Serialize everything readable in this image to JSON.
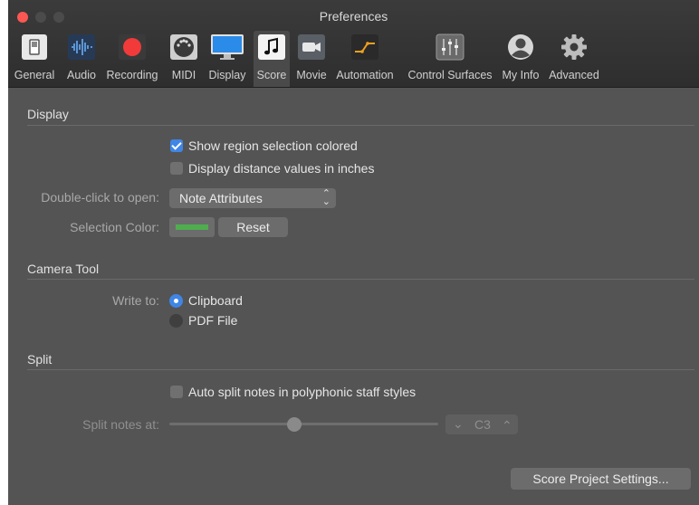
{
  "window": {
    "title": "Preferences"
  },
  "toolbar": {
    "items": [
      {
        "label": "General",
        "icon": "switch-icon"
      },
      {
        "label": "Audio",
        "icon": "waveform-icon"
      },
      {
        "label": "Recording",
        "icon": "record-icon"
      },
      {
        "label": "MIDI",
        "icon": "midi-connector-icon"
      },
      {
        "label": "Display",
        "icon": "monitor-icon"
      },
      {
        "label": "Score",
        "icon": "music-note-icon",
        "active": true
      },
      {
        "label": "Movie",
        "icon": "video-camera-icon"
      },
      {
        "label": "Automation",
        "icon": "automation-curve-icon"
      },
      {
        "label": "Control Surfaces",
        "icon": "faders-icon"
      },
      {
        "label": "My Info",
        "icon": "user-icon"
      },
      {
        "label": "Advanced",
        "icon": "gear-icon"
      }
    ]
  },
  "display_section": {
    "title": "Display",
    "show_region_selection_colored": {
      "label": "Show region selection colored",
      "checked": true
    },
    "display_distance_inches": {
      "label": "Display distance values in inches",
      "checked": false
    },
    "double_click": {
      "label": "Double-click to open:",
      "value": "Note Attributes"
    },
    "selection_color": {
      "label": "Selection Color:",
      "color": "#4fad50",
      "reset_label": "Reset"
    }
  },
  "camera_section": {
    "title": "Camera Tool",
    "write_to_label": "Write to:",
    "options": [
      {
        "label": "Clipboard",
        "selected": true
      },
      {
        "label": "PDF File",
        "selected": false
      }
    ]
  },
  "split_section": {
    "title": "Split",
    "auto_split": {
      "label": "Auto split notes in polyphonic staff styles",
      "checked": false
    },
    "split_notes_at": {
      "label": "Split notes at:",
      "value": "C3",
      "down": "⌄",
      "up": "⌃"
    }
  },
  "footer": {
    "project_settings_label": "Score Project Settings..."
  },
  "colors": {
    "accent": "#3f86e6",
    "close": "#fc5753",
    "background": "#545454"
  }
}
